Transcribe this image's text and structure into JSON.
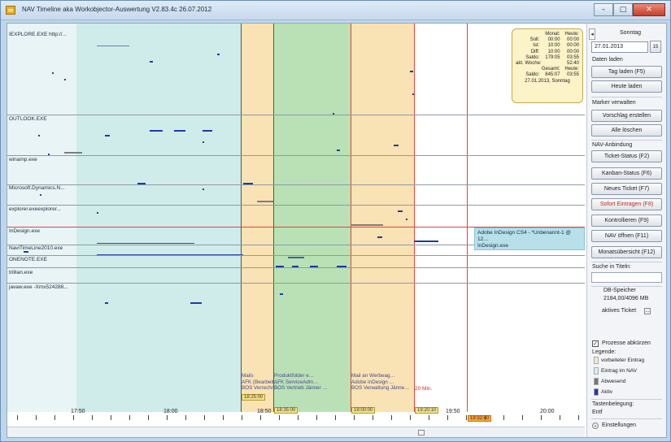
{
  "window": {
    "title": "NAV Timeline aka Workobjector-Auswertung V2.83.4c 26.07.2012",
    "minimize_glyph": "–",
    "maximize_glyph": "□",
    "close_glyph": "✕"
  },
  "timeline": {
    "rows": [
      {
        "label": "IEXPLORE.EXE http://..."
      },
      {
        "label": "OUTLOOK.EXE"
      },
      {
        "label": "winamp.exe"
      },
      {
        "label": "Microsoft.Dynamics.N..."
      },
      {
        "label": "explorer.exeexplorer..."
      },
      {
        "label": "InDesign.exe"
      },
      {
        "label": "NaviTimeLine2010.exe"
      },
      {
        "label": "ONENOTE.EXE"
      },
      {
        "label": "trillian.exe"
      },
      {
        "label": "javaw.exe -Xmx524288..."
      }
    ],
    "axis_labels": [
      "17:50",
      "18:00",
      "18:50",
      "19:50",
      "20:00"
    ],
    "summary": {
      "header_month": "Monat:",
      "header_today": "Heute:",
      "rows": [
        {
          "k": "Soll:",
          "month": "00:00",
          "today": "00:00"
        },
        {
          "k": "Ist:",
          "month": "10:00",
          "today": "00:00"
        },
        {
          "k": "Diff:",
          "month": "10:00",
          "today": "00:00"
        },
        {
          "k": "Saldo:",
          "month": "179:05",
          "today": "03:55"
        },
        {
          "k": "akt. Woche:",
          "month": "",
          "today": "52:40"
        },
        {
          "k": "",
          "month": "Gesamt:",
          "today": "Heute:"
        },
        {
          "k": "Saldo:",
          "month": "845:07",
          "today": "03:55"
        }
      ],
      "footer": "27.01.2013, Sonntag"
    },
    "tooltip": {
      "line1": "Adobe InDesign CS4 - *Unbenannt-1 @ 12…",
      "line2": "InDesign.exe"
    },
    "band_notes": {
      "b1": [
        "Mails",
        "AFK (Bearbeit…",
        "BOS Verrechn…"
      ],
      "b2": [
        "Produktfolder e…",
        "AFK ServiceAdm…",
        "BOS Vertrieb Jänner …"
      ],
      "b3": [
        "Mail an Werbeag…",
        "Adobe InDesign …",
        "BOS Verwaltung Jänne…"
      ]
    },
    "time_tags": [
      "18:25:00",
      "18:35:00",
      "19:00:00",
      "19:20:10",
      "19:32:40"
    ],
    "red_note": "20 Min."
  },
  "panel": {
    "weekday": "Sonntag",
    "date": "27.01.2013",
    "cal_btn": "15",
    "prev_glyph": "◂",
    "next_glyph": "▸",
    "daten_laden": "Daten laden",
    "tag_laden": "Tag laden (F5)",
    "heute_laden": "Heute laden",
    "marker_verwalten": "Marker verwalten",
    "vorschlag": "Vorschlag erstellen",
    "alle_loeschen": "Alle löschen",
    "nav_anbindung": "NAV-Anbindung",
    "ticket_status": "Ticket-Status (F2)",
    "kanban_status": "Kanban-Status (F6)",
    "neues_ticket": "Neues Ticket (F7)",
    "sofort_eintragen": "Sofort Eintragen (F8)",
    "kontrollieren": "Kontrollieren (F9)",
    "nav_oeffnen": "NAV öffnen (F11)",
    "monatsuebersicht": "Monatsübersicht (F12)",
    "suche": "Suche in Titeln:",
    "db_speicher": "DB-Speicher",
    "db_value": "2184,00/4096 MB",
    "aktives_ticket": "aktives Ticket",
    "aktives_ticket_btn": "...",
    "prozesse": "Prozesse abkürzen",
    "checkmark": "✓",
    "legende": "Legende:",
    "legend": [
      {
        "label": "vorbeiteter Eintrag",
        "color": "#f4ecc0"
      },
      {
        "label": "Eintrag im NAV",
        "color": "#d8ecf8"
      },
      {
        "label": "Abwesend",
        "color": "#777777"
      },
      {
        "label": "Aktiv",
        "color": "#1c3ca8"
      }
    ],
    "tastenbelegung": "Tastenbelegung:",
    "entf": "Entf",
    "einstellungen": "Einstellungen",
    "chevron_glyph": "⌄"
  }
}
